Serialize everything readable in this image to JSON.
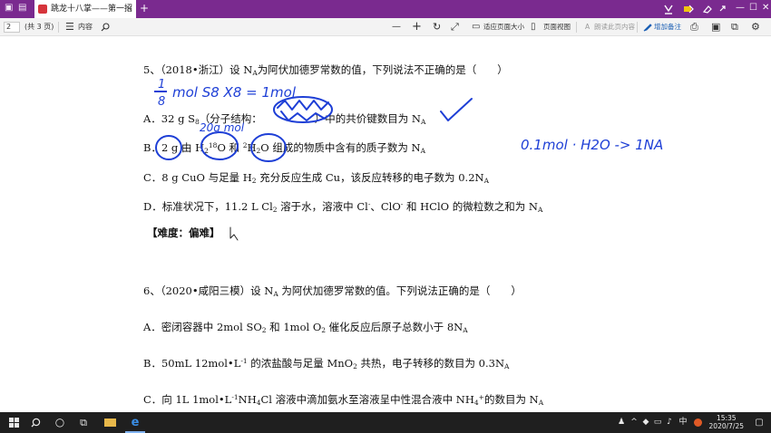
{
  "titlebar": {
    "tab_title": "跳龙十八掌——第一招",
    "tab_close": "×",
    "new_tab": "+",
    "controls": {
      "minimize": "—",
      "maximize": "☐",
      "close": "✕"
    }
  },
  "toolbar": {
    "page_number": "2",
    "page_total": "(共 3 页)",
    "contents_label": "内容",
    "fit_page_label": "适应页面大小",
    "page_view_label": "页面视图",
    "read_aloud_label": "朗读此页内容",
    "add_note_label": "增加备注",
    "zoom_out": "—",
    "zoom_in": "+"
  },
  "document": {
    "q5": {
      "stem_prefix": "5、（2018•浙江）设 N",
      "stem_sub": "A",
      "stem_suffix": "为阿伏加德罗常数的值，下列说法不正确的是（　　）",
      "a_prefix": "A．32 g S",
      "a_sub1": "8",
      "a_mid": "（分子结构：",
      "a_suffix": "）中的共价键数目为 N",
      "a_sub2": "A",
      "b_p1": "B．2 g 由 H",
      "b_sub1": "2",
      "b_sup1": "18",
      "b_p2": "O 和 ",
      "b_sup2": "2",
      "b_p3": "H",
      "b_sub2": "2",
      "b_p4": "O 组成的物质中含有的质子数为 N",
      "b_sub3": "A",
      "c_p1": "C．8 g CuO 与足量 H",
      "c_sub1": "2",
      "c_p2": " 充分反应生成 Cu，该反应转移的电子数为 0.2N",
      "c_sub2": "A",
      "d_p1": "D．标准状况下，11.2 L Cl",
      "d_sub1": "2",
      "d_p2": " 溶于水，溶液中 Cl",
      "d_sup1": "-",
      "d_p3": "、ClO",
      "d_sup2": "-",
      "d_p4": " 和 HClO 的微粒数之和为 N",
      "d_sub2": "A",
      "difficulty": "【难度：偏难】"
    },
    "q6": {
      "stem_prefix": "6、（2020•咸阳三模）设 N",
      "stem_sub": "A",
      "stem_suffix": " 为阿伏加德罗常数的值。下列说法正确的是（　　）",
      "a_p1": "A．密闭容器中 2mol SO",
      "a_sub1": "2",
      "a_p2": " 和 1mol O",
      "a_sub2": "2",
      "a_p3": " 催化反应后原子总数小于 8N",
      "a_sub3": "A",
      "b_p1": "B．50mL 12mol•L",
      "b_sup1": "-1",
      "b_p2": " 的浓盐酸与足量 MnO",
      "b_sub1": "2",
      "b_p3": " 共热，电子转移的数目为 0.3N",
      "b_sub2": "A",
      "c_p1": "C．向 1L 1mol•L",
      "c_sup1": "-1",
      "c_p2": "NH",
      "c_sub1": "4",
      "c_p3": "Cl 溶液中滴加氨水至溶液呈中性混合液中 NH",
      "c_sub2": "4",
      "c_sup2": "+",
      "c_p4": "的数目为 N",
      "c_sub3": "A"
    },
    "ink_notes": {
      "frac_num": "1",
      "frac_den": "8",
      "note_top": "mol S8 X8 = 1mol",
      "note_b": "20g mol",
      "note_right": "0.1mol · H2O -> 1NA"
    }
  },
  "taskbar": {
    "tray_lang": "中",
    "time": "15:35",
    "date": "2020/7/25"
  },
  "colors": {
    "titlebar": "#7a2a8f",
    "ink": "#1e3fd6",
    "taskbar": "#1f1f1f"
  }
}
